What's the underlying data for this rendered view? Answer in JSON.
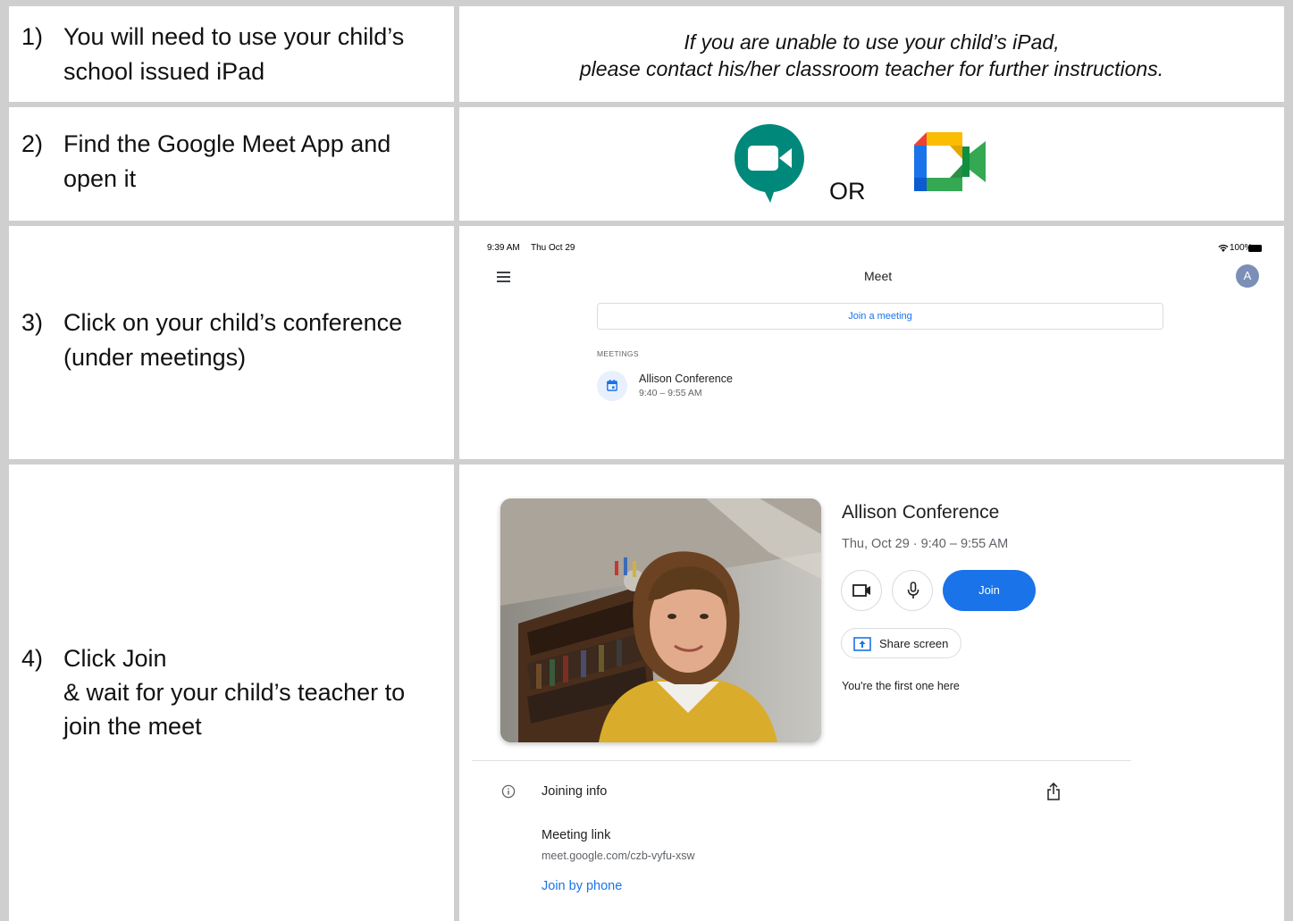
{
  "steps": [
    {
      "num": "1)",
      "lines": [
        "You will need to use your child’s",
        "school issued iPad"
      ]
    },
    {
      "num": "2)",
      "lines": [
        "Find the Google Meet App and",
        "open it"
      ]
    },
    {
      "num": "3)",
      "lines": [
        "Click on your child’s conference",
        "(under meetings)"
      ]
    },
    {
      "num": "4)",
      "lines": [
        "Click Join",
        "& wait for your child’s teacher to",
        "join the meet"
      ]
    }
  ],
  "note": {
    "line1": "If you are unable to use your child’s iPad,",
    "line2": "please contact his/her classroom teacher for further instructions."
  },
  "icons": {
    "or_label": "OR",
    "old_icon": "google-meet-old-icon",
    "new_icon": "google-meet-new-icon",
    "colors": {
      "old_green": "#00897b",
      "blue": "#1a73e8",
      "red": "#ea4335",
      "yellow": "#fbbc04",
      "green": "#34a853"
    }
  },
  "ipad": {
    "time": "9:39 AM",
    "date": "Thu Oct 29",
    "battery": "100%",
    "title": "Meet",
    "avatar_letter": "A",
    "join_label": "Join a meeting",
    "meetings_label": "MEETINGS",
    "meeting_name": "Allison Conference",
    "meeting_time": "9:40 – 9:55 AM"
  },
  "prejoin": {
    "conference_title": "Allison Conference",
    "date_time": "Thu, Oct 29 · 9:40 – 9:55 AM",
    "join_button": "Join",
    "share_screen": "Share screen",
    "first_one": "You're the first one here",
    "joining_info": "Joining info",
    "meeting_link_label": "Meeting link",
    "meeting_link": "meet.google.com/czb-vyfu-xsw",
    "join_by_phone": "Join by phone"
  }
}
